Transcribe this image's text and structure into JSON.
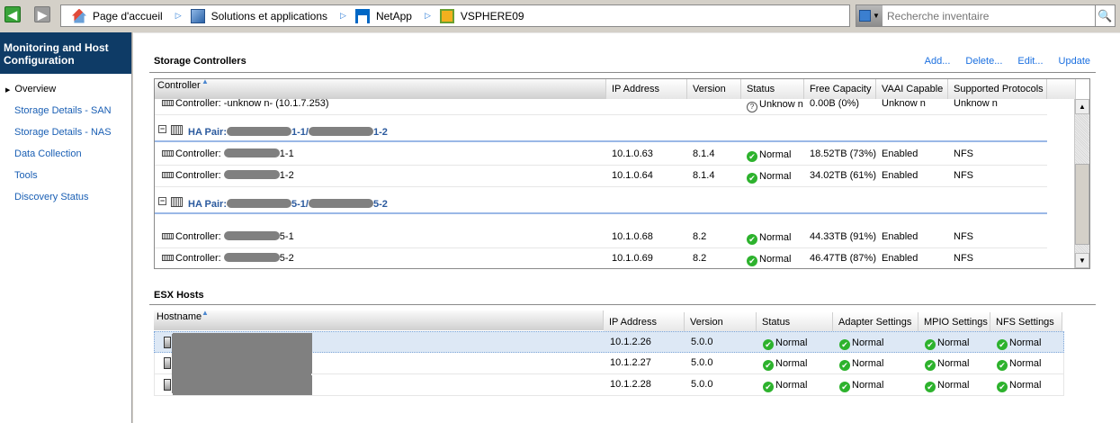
{
  "nav": {
    "back_icon": "arrow-left-icon",
    "forward_icon": "arrow-right-icon"
  },
  "breadcrumb": [
    {
      "label": "Page d'accueil",
      "icon": "home-icon"
    },
    {
      "label": "Solutions et applications",
      "icon": "solutions-icon"
    },
    {
      "label": "NetApp",
      "icon": "netapp-icon"
    },
    {
      "label": "VSPHERE09",
      "icon": "vsphere-icon"
    }
  ],
  "search": {
    "placeholder": "Recherche inventaire"
  },
  "sidebar": {
    "title": "Monitoring and Host Configuration",
    "items": [
      {
        "label": "Overview",
        "active": true
      },
      {
        "label": "Storage Details - SAN"
      },
      {
        "label": "Storage Details - NAS"
      },
      {
        "label": "Data Collection"
      },
      {
        "label": "Tools"
      },
      {
        "label": "Discovery Status"
      }
    ]
  },
  "storage": {
    "title": "Storage Controllers",
    "actions": [
      "Add...",
      "Delete...",
      "Edit...",
      "Update"
    ],
    "columns": [
      "Controller",
      "IP Address",
      "Version",
      "Status",
      "Free Capacity",
      "VAAI Capable",
      "Supported Protocols"
    ],
    "rows": [
      {
        "type": "controller",
        "name": "Controller: -unknow n- (10.1.7.253)",
        "ip": "",
        "version": "",
        "status": "Unknow n",
        "status_kind": "unknown",
        "free": "0.00B (0%)",
        "vaai": "Unknow n",
        "protocols": "Unknow n"
      },
      {
        "type": "group",
        "prefix": "HA Pair:",
        "mid": "1-1/",
        "suffix": "1-2"
      },
      {
        "type": "controller",
        "name": "Controller: ",
        "suffix": "1-1",
        "ip": "10.1.0.63",
        "version": "8.1.4",
        "status": "Normal",
        "status_kind": "ok",
        "free": "18.52TB (73%)",
        "vaai": "Enabled",
        "protocols": "NFS"
      },
      {
        "type": "controller",
        "name": "Controller: ",
        "suffix": "1-2",
        "ip": "10.1.0.64",
        "version": "8.1.4",
        "status": "Normal",
        "status_kind": "ok",
        "free": "34.02TB (61%)",
        "vaai": "Enabled",
        "protocols": "NFS"
      },
      {
        "type": "group",
        "prefix": "HA Pair:",
        "mid": "5-1/",
        "suffix": "5-2"
      },
      {
        "type": "controller",
        "name": "Controller: ",
        "suffix": "5-1",
        "ip": "10.1.0.68",
        "version": "8.2",
        "status": "Normal",
        "status_kind": "ok",
        "free": "44.33TB (91%)",
        "vaai": "Enabled",
        "protocols": "NFS"
      },
      {
        "type": "controller",
        "name": "Controller: ",
        "suffix": "5-2",
        "ip": "10.1.0.69",
        "version": "8.2",
        "status": "Normal",
        "status_kind": "ok",
        "free": "46.47TB (87%)",
        "vaai": "Enabled",
        "protocols": "NFS"
      }
    ]
  },
  "esx": {
    "title": "ESX Hosts",
    "columns": [
      "Hostname",
      "IP Address",
      "Version",
      "Status",
      "Adapter Settings",
      "MPIO Settings",
      "NFS Settings"
    ],
    "rows": [
      {
        "ip": "10.1.2.26",
        "version": "5.0.0",
        "status": "Normal",
        "adapter": "Normal",
        "mpio": "Normal",
        "nfs": "Normal",
        "selected": true
      },
      {
        "ip": "10.1.2.27",
        "version": "5.0.0",
        "status": "Normal",
        "adapter": "Normal",
        "mpio": "Normal",
        "nfs": "Normal"
      },
      {
        "ip": "10.1.2.28",
        "version": "5.0.0",
        "status": "Normal",
        "adapter": "Normal",
        "mpio": "Normal",
        "nfs": "Normal"
      }
    ]
  },
  "colors": {
    "sidebar_header": "#0e3b66",
    "link": "#1a6fe0",
    "ok": "#2db22d",
    "group_line": "#9ab8e6",
    "selected_row": "#dde8f5"
  }
}
